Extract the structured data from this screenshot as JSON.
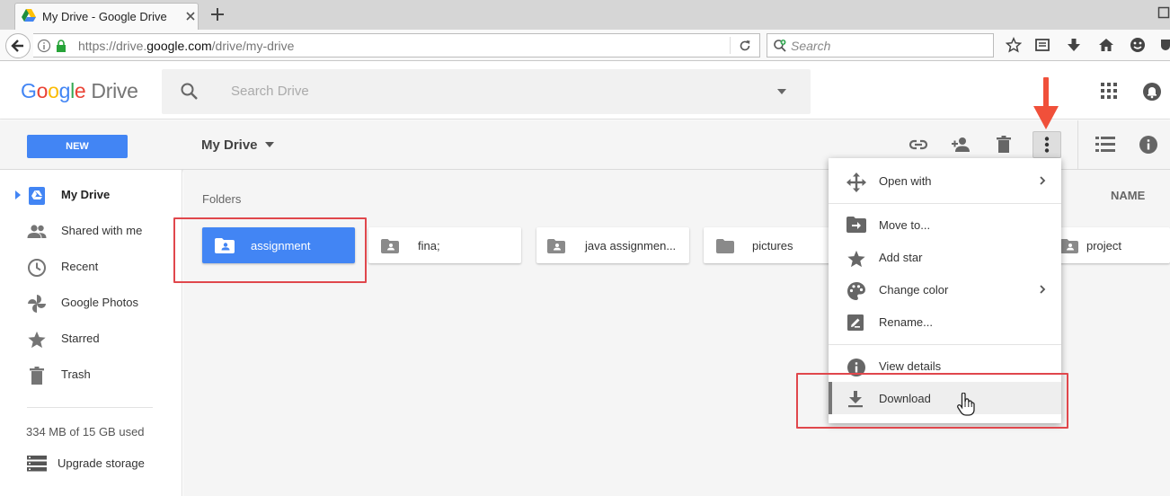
{
  "browser": {
    "tab_title": "My Drive - Google Drive",
    "url_prefix": "https://drive.",
    "url_domain": "google.com",
    "url_path": "/drive/my-drive",
    "search_placeholder": "Search"
  },
  "header": {
    "logo_google": "Google",
    "logo_product": "Drive",
    "search_placeholder": "Search Drive"
  },
  "toolbar": {
    "new_label": "NEW",
    "location": "My Drive"
  },
  "sidebar": {
    "items": [
      {
        "label": "My Drive",
        "icon": "drive-icon",
        "active": true
      },
      {
        "label": "Shared with me",
        "icon": "people-icon"
      },
      {
        "label": "Recent",
        "icon": "clock-icon"
      },
      {
        "label": "Google Photos",
        "icon": "pinwheel-icon"
      },
      {
        "label": "Starred",
        "icon": "star-icon"
      },
      {
        "label": "Trash",
        "icon": "trash-icon"
      }
    ],
    "quota": "334 MB of 15 GB used",
    "upgrade": "Upgrade storage"
  },
  "main": {
    "section_label": "Folders",
    "sort_label": "NAME",
    "folders": [
      {
        "name": "assignment",
        "shared": true,
        "selected": true
      },
      {
        "name": "fina;",
        "shared": true
      },
      {
        "name": "java assignmen...",
        "shared": true
      },
      {
        "name": "pictures",
        "shared": false
      },
      {
        "name": "project",
        "shared": true
      }
    ]
  },
  "context_menu": {
    "items": [
      {
        "label": "Open with",
        "icon": "move-arrows-icon",
        "submenu": true
      },
      {
        "label": "Move to...",
        "icon": "move-to-icon"
      },
      {
        "label": "Add star",
        "icon": "star-icon"
      },
      {
        "label": "Change color",
        "icon": "palette-icon",
        "submenu": true
      },
      {
        "label": "Rename...",
        "icon": "rename-icon"
      },
      {
        "label": "View details",
        "icon": "info-icon"
      },
      {
        "label": "Download",
        "icon": "download-icon",
        "highlighted": true
      }
    ]
  },
  "colors": {
    "accent": "#4285f4",
    "annotation_red": "#e0474c",
    "arrow_red": "#f0503a"
  }
}
